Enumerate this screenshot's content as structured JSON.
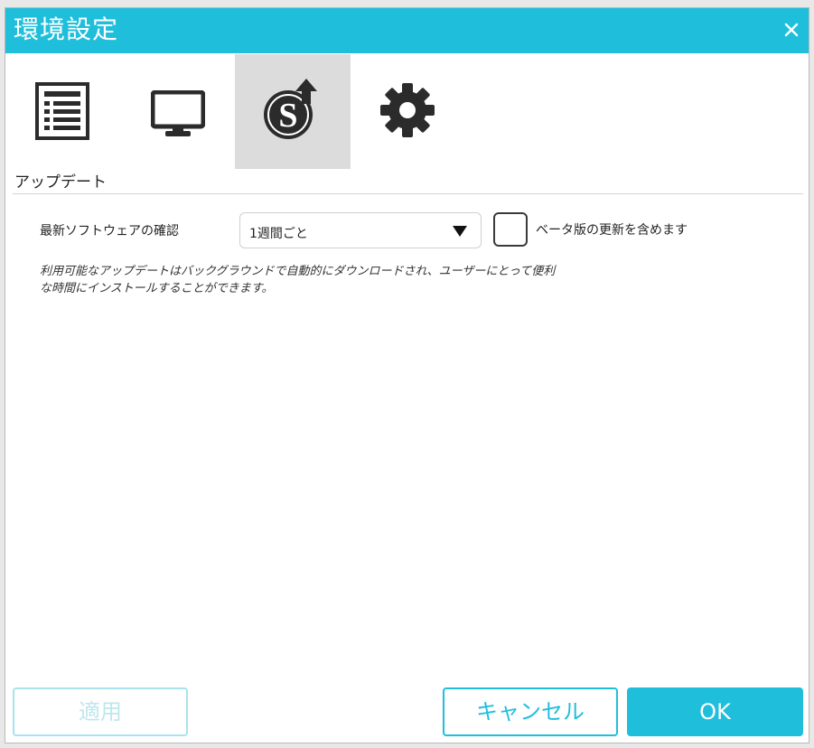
{
  "window": {
    "title": "環境設定",
    "close_icon": "close-icon"
  },
  "tabs": [
    {
      "icon": "list-icon",
      "active": false
    },
    {
      "icon": "monitor-icon",
      "active": false
    },
    {
      "icon": "software-update-icon",
      "active": true
    },
    {
      "icon": "gear-icon",
      "active": false
    }
  ],
  "section": {
    "title": "アップデート"
  },
  "update_check": {
    "label": "最新ソフトウェアの確認",
    "frequency_value": "1週間ごと",
    "beta_label": "ベータ版の更新を含めます",
    "beta_checked": false
  },
  "description": {
    "line1": "利用可能なアップデートはバックグラウンドで自動的にダウンロードされ、ユーザーにとって便利",
    "line2": "な時間にインストールすることができます。"
  },
  "buttons": {
    "apply": "適用",
    "cancel": "キャンセル",
    "ok": "OK"
  },
  "colors": {
    "accent": "#1fbfdc",
    "active_tab": "#dcdcdc",
    "disabled": "#a8e2ee"
  }
}
